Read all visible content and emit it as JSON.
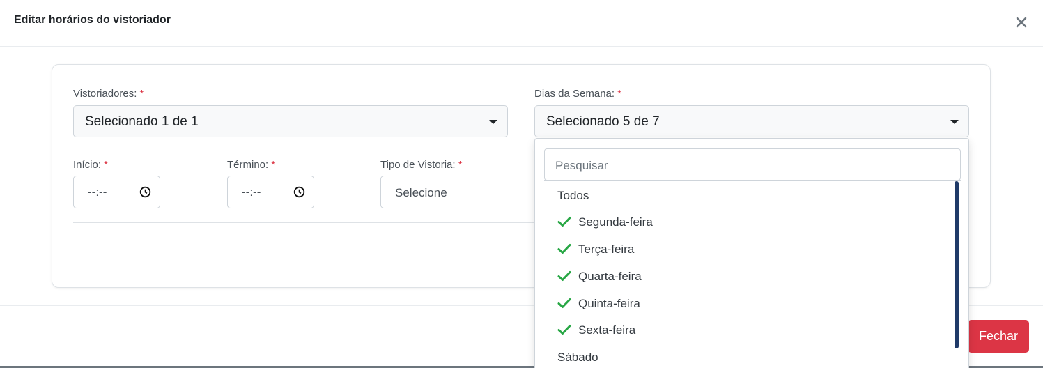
{
  "modal": {
    "title": "Editar horários do vistoriador",
    "close_symbol": "×"
  },
  "form": {
    "vistoriadores": {
      "label": "Vistoriadores:",
      "required": "*",
      "value": "Selecionado 1 de 1"
    },
    "dias_semana": {
      "label": "Dias da Semana:",
      "required": "*",
      "value": "Selecionado 5 de 7"
    },
    "inicio": {
      "label": "Início:",
      "required": "*",
      "value": "--:--"
    },
    "termino": {
      "label": "Término:",
      "required": "*",
      "value": "--:--"
    },
    "tipo_vistoria": {
      "label": "Tipo de Vistoria:",
      "required": "*",
      "value": "Selecione"
    }
  },
  "dias_menu": {
    "search_placeholder": "Pesquisar",
    "options": [
      {
        "label": "Todos",
        "checked": false
      },
      {
        "label": "Segunda-feira",
        "checked": true
      },
      {
        "label": "Terça-feira",
        "checked": true
      },
      {
        "label": "Quarta-feira",
        "checked": true
      },
      {
        "label": "Quinta-feira",
        "checked": true
      },
      {
        "label": "Sexta-feira",
        "checked": true
      },
      {
        "label": "Sábado",
        "checked": false
      }
    ]
  },
  "footer": {
    "close_label": "Fechar"
  },
  "colors": {
    "danger": "#dc3545",
    "check": "#28a745",
    "scrollbar": "#1f3a68"
  }
}
